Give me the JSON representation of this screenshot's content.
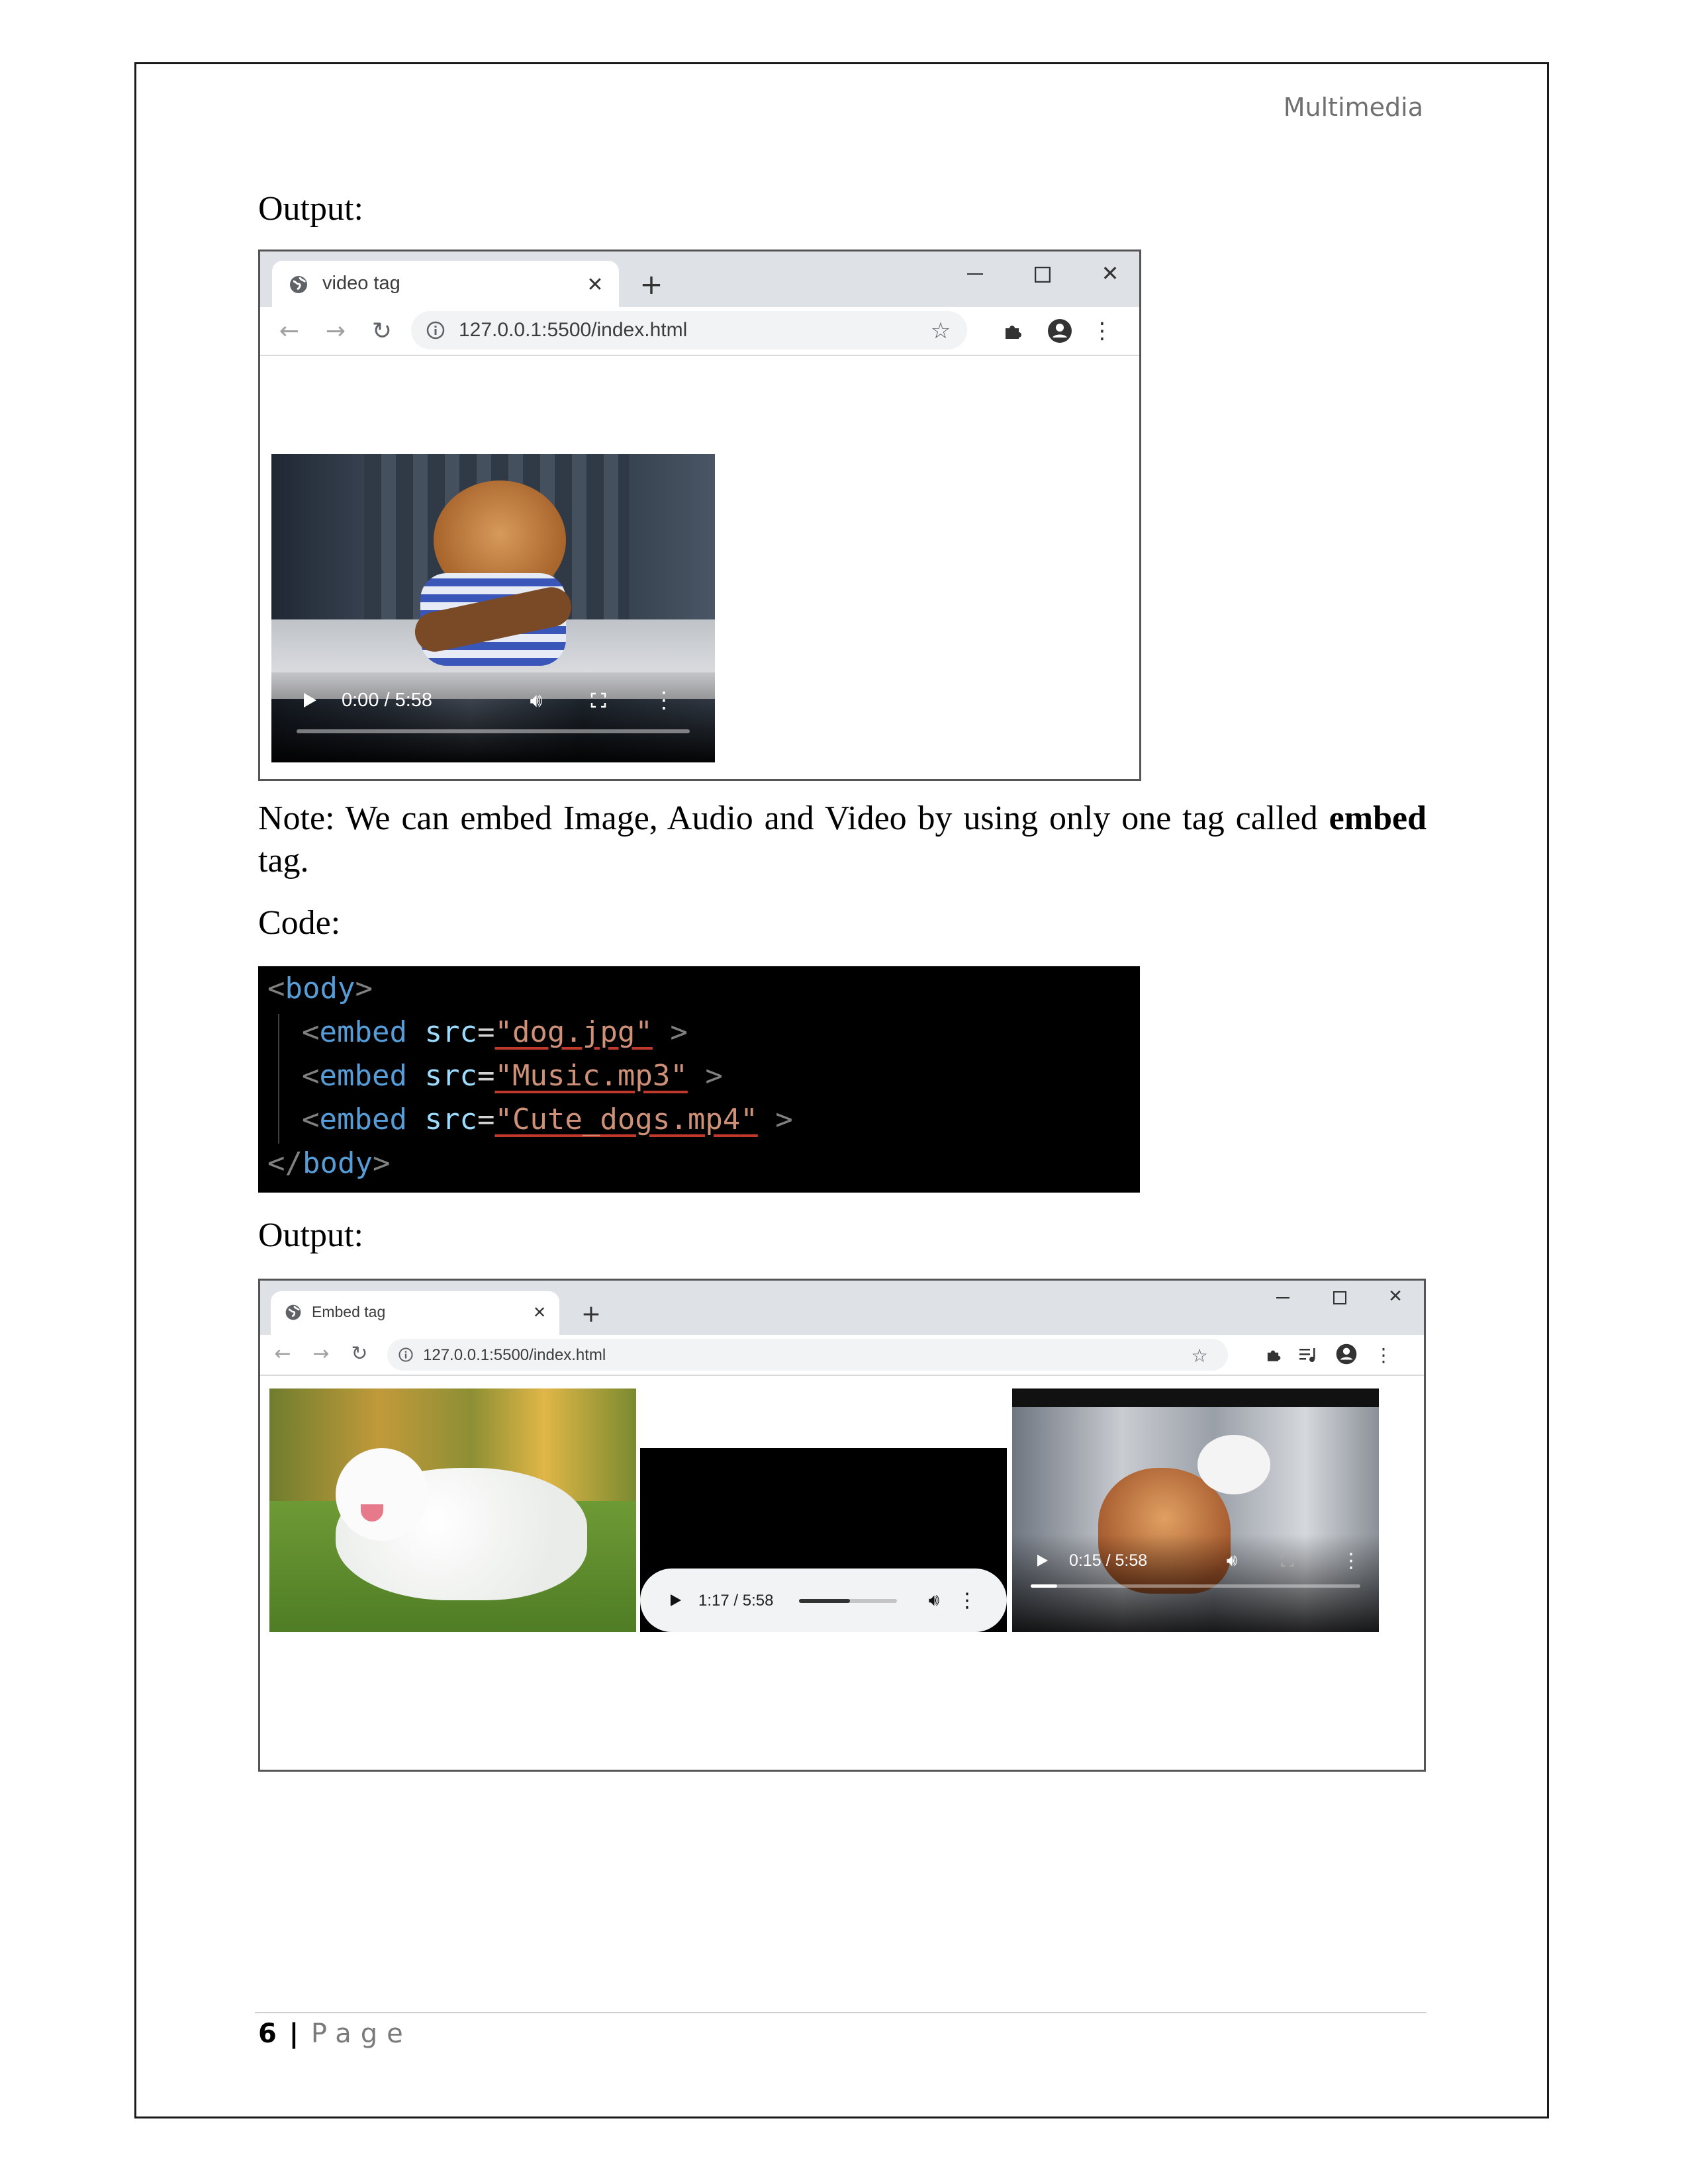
{
  "header": {
    "running_title": "Multimedia"
  },
  "section1": {
    "label": "Output:"
  },
  "browser1": {
    "tab_title": "video tag",
    "new_tab": "+",
    "url": "127.0.0.1:5500/index.html",
    "video": {
      "time": "0:00 / 5:58"
    }
  },
  "note": {
    "text": "Note: We can embed Image, Audio and Video by using only one tag called ",
    "bold": "embed",
    "tail": " tag."
  },
  "code_label": "Code:",
  "code": {
    "open_lt": "<",
    "open_name": "body",
    "open_gt": ">",
    "lines": [
      {
        "lt": "<",
        "tag": "embed",
        "attr": "src",
        "eq": "=",
        "q1": "\"",
        "val": "dog.jpg",
        "q2": "\"",
        "gt": " >"
      },
      {
        "lt": "<",
        "tag": "embed",
        "attr": "src",
        "eq": "=",
        "q1": "\"",
        "val": "Music.mp3",
        "q2": "\"",
        "gt": " >"
      },
      {
        "lt": "<",
        "tag": "embed",
        "attr": "src",
        "eq": "=",
        "q1": "\"",
        "val": "Cute_dogs.mp4",
        "q2": "\"",
        "gt": " >"
      }
    ],
    "close_lt": "</",
    "close_name": "body",
    "close_gt": ">"
  },
  "section2": {
    "label": "Output:"
  },
  "browser2": {
    "tab_title": "Embed tag",
    "new_tab": "+",
    "url": "127.0.0.1:5500/index.html",
    "audio": {
      "time": "1:17 / 5:58",
      "progress": 0.52
    },
    "video": {
      "time": "0:15 / 5:58",
      "progress": 0.08
    }
  },
  "footer": {
    "page_number": "6",
    "separator": "|",
    "page_word": "Page"
  }
}
